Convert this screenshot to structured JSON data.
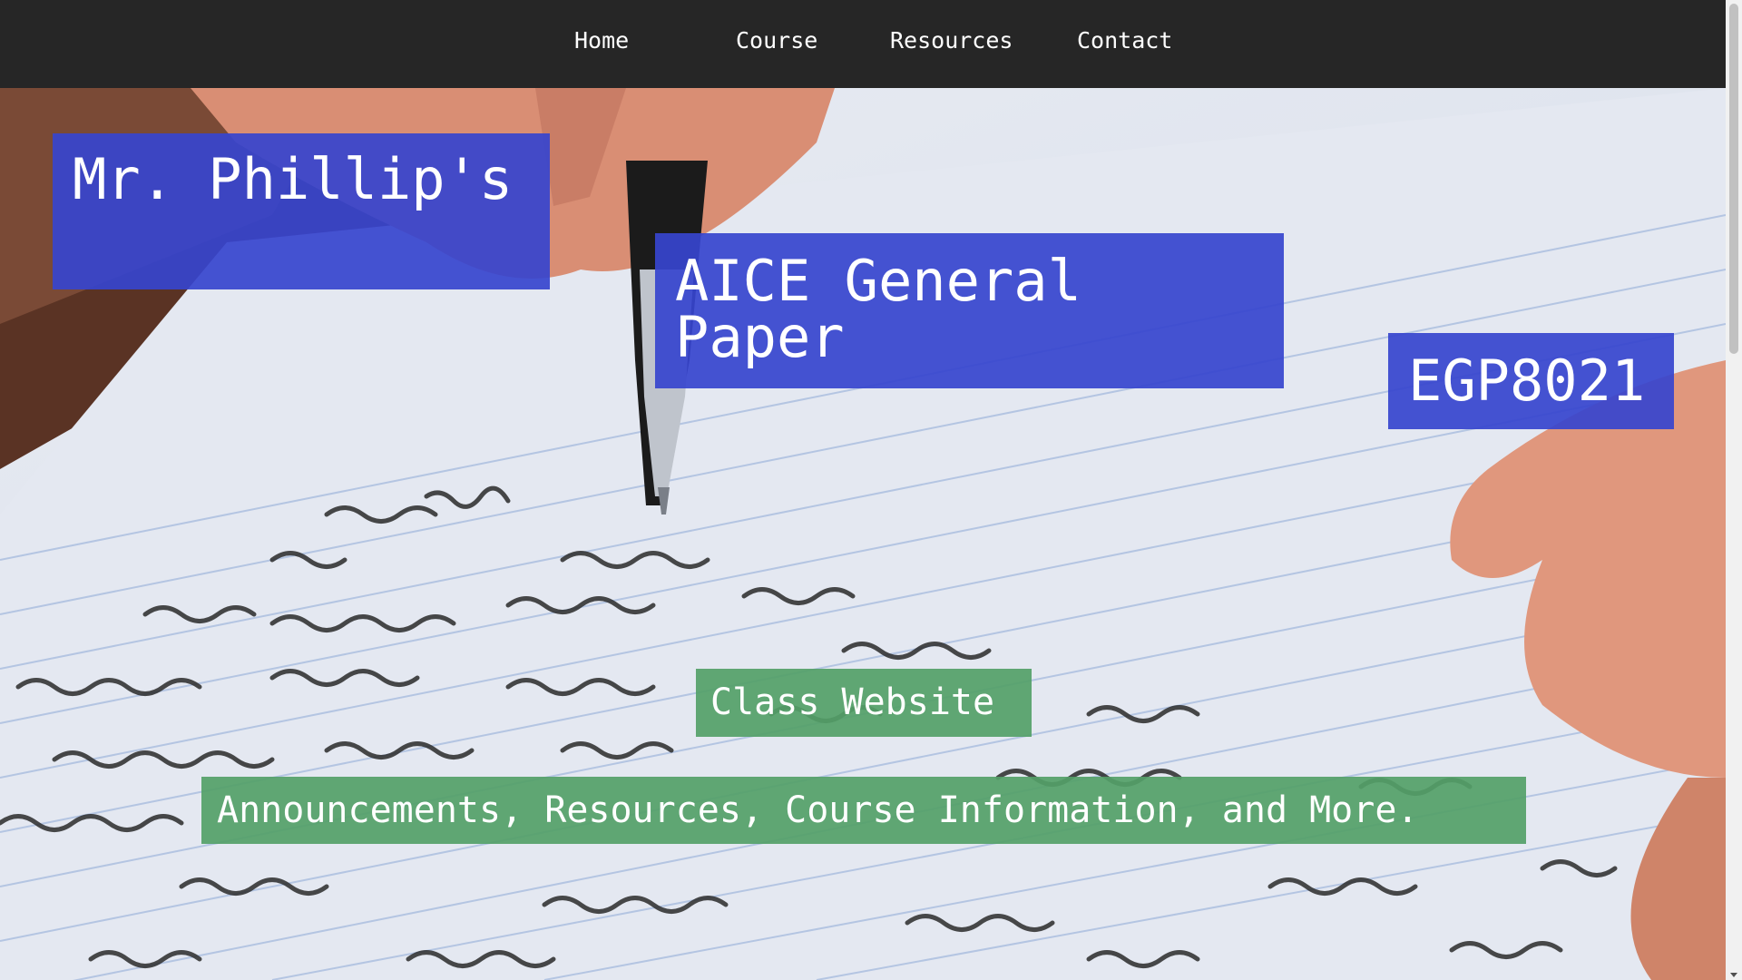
{
  "nav": {
    "items": [
      {
        "label": "Home"
      },
      {
        "label": "Course"
      },
      {
        "label": "Resources"
      },
      {
        "label": "Contact"
      }
    ]
  },
  "hero": {
    "owner": "Mr. Phillip's",
    "course": "AICE General Paper",
    "code": "EGP8021",
    "subtitle": "Class Website",
    "tagline": "Announcements, Resources, Course Information, and More.",
    "background": "photo of a hand writing with a pen on lined notebook paper"
  },
  "colors": {
    "navbar": "#262626",
    "banner_blue": "#3644ce",
    "banner_green": "#54a068",
    "text": "#ffffff"
  }
}
